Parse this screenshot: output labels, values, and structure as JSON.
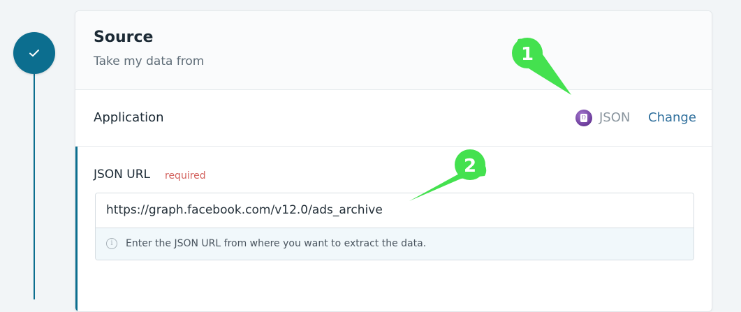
{
  "step": {
    "status": "completed",
    "icon": "check-icon"
  },
  "source": {
    "title": "Source",
    "subtitle": "Take my data from"
  },
  "application": {
    "label": "Application",
    "app_name": "JSON",
    "app_icon": "json-app-icon",
    "change_label": "Change"
  },
  "json_url": {
    "label": "JSON URL",
    "required_label": "required",
    "value": "https://graph.facebook.com/v12.0/ads_archive",
    "help_icon": "info-icon",
    "help_text": "Enter the JSON URL from where you want to extract the data."
  },
  "annotations": [
    {
      "label": "1",
      "color": "#44e14f"
    },
    {
      "label": "2",
      "color": "#44e14f"
    }
  ],
  "colors": {
    "accent": "#0c6e8f",
    "link": "#2f6f9c",
    "required": "#d3625e",
    "annotation_green": "#44e14f"
  }
}
